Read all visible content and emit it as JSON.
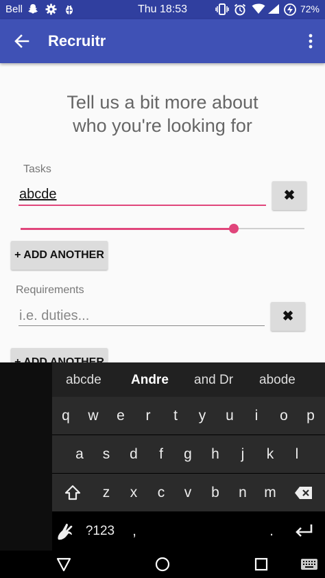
{
  "status_bar": {
    "carrier": "Bell",
    "time": "Thu 18:53",
    "battery": "72%",
    "icons": [
      "snapchat-icon",
      "gear-icon",
      "bug-icon",
      "vibrate-icon",
      "alarm-icon",
      "wifi-icon",
      "signal-icon",
      "battery-icon"
    ]
  },
  "app_bar": {
    "title": "Recruitr",
    "back_icon": "arrow-left-icon",
    "menu_icon": "more-vertical-icon",
    "color": "#3f51b5"
  },
  "heading": {
    "line1": "Tell us a bit more about",
    "line2": "who you're looking for"
  },
  "tasks": {
    "label": "Tasks",
    "value": "abcde",
    "remove_label": "✖",
    "slider_value": 0.75,
    "add_label": "+ ADD ANOTHER"
  },
  "requirements": {
    "label": "Requirements",
    "placeholder": "i.e. duties...",
    "remove_label": "✖",
    "add_label": "+ ADD ANOTHER"
  },
  "accent_color": "#e0457b",
  "keyboard": {
    "suggestions": [
      "abcde",
      "Andre",
      "and Dr",
      "abode"
    ],
    "row1": [
      "q",
      "w",
      "e",
      "r",
      "t",
      "y",
      "u",
      "i",
      "o",
      "p"
    ],
    "row2": [
      "a",
      "s",
      "d",
      "f",
      "g",
      "h",
      "j",
      "k",
      "l"
    ],
    "row3_letters": [
      "z",
      "x",
      "c",
      "v",
      "b",
      "n",
      "m"
    ],
    "symbols_label": "?123",
    "comma": ",",
    "period": "."
  },
  "nav_bar": {
    "icons": [
      "back-triangle-icon",
      "home-circle-icon",
      "recents-square-icon",
      "keyboard-toggle-icon"
    ]
  }
}
